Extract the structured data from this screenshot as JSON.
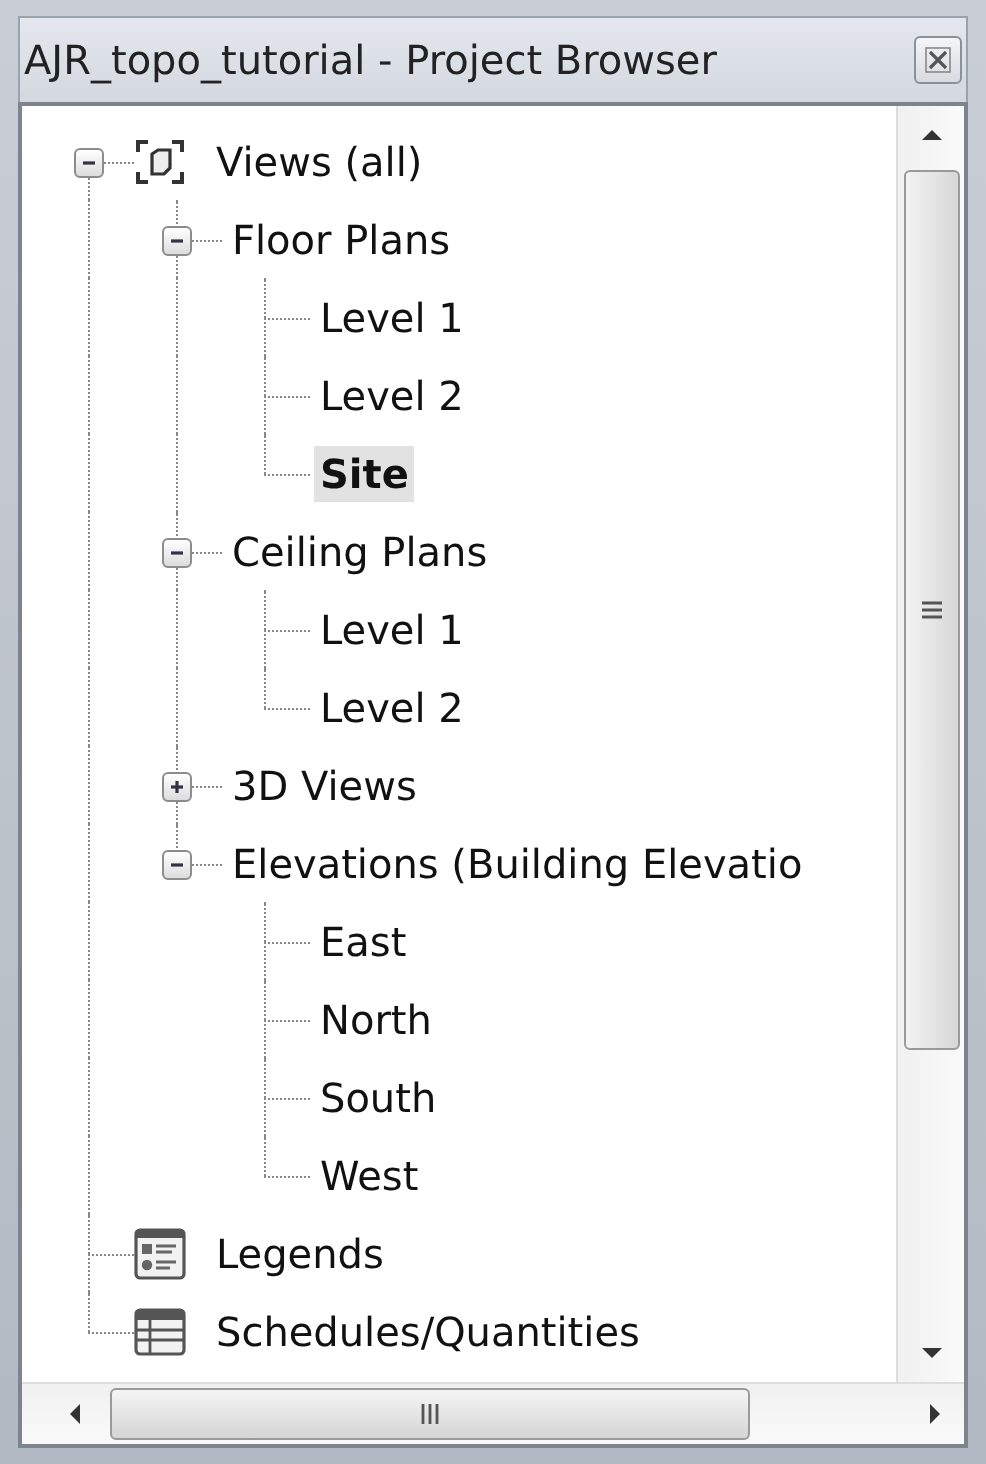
{
  "window": {
    "title": "AJR_topo_tutorial - Project Browser"
  },
  "tree": [
    {
      "label": "Views (all)",
      "kind": "views",
      "expanded": true,
      "selected": false,
      "children": [
        {
          "label": "Floor Plans",
          "expanded": true,
          "selected": false,
          "children": [
            {
              "label": "Level 1",
              "selected": false
            },
            {
              "label": "Level 2",
              "selected": false
            },
            {
              "label": "Site",
              "selected": true
            }
          ]
        },
        {
          "label": "Ceiling Plans",
          "expanded": true,
          "selected": false,
          "children": [
            {
              "label": "Level 1",
              "selected": false
            },
            {
              "label": "Level 2",
              "selected": false
            }
          ]
        },
        {
          "label": "3D Views",
          "expanded": false,
          "selected": false
        },
        {
          "label": "Elevations (Building Elevatio",
          "expanded": true,
          "selected": false,
          "children": [
            {
              "label": "East",
              "selected": false
            },
            {
              "label": "North",
              "selected": false
            },
            {
              "label": "South",
              "selected": false
            },
            {
              "label": "West",
              "selected": false
            }
          ]
        }
      ]
    },
    {
      "label": "Legends",
      "kind": "legends",
      "selected": false
    },
    {
      "label": "Schedules/Quantities",
      "kind": "schedules",
      "selected": false
    }
  ]
}
